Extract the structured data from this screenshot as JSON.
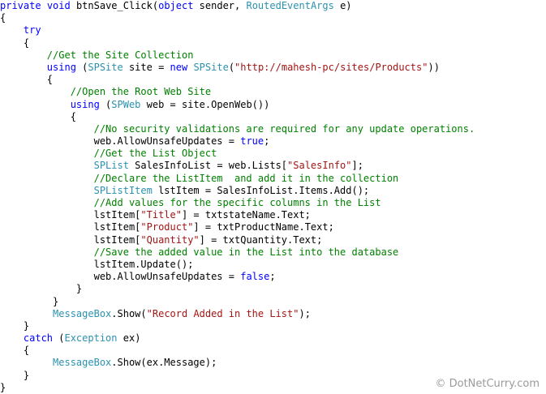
{
  "colors": {
    "keyword": "#0000ff",
    "type": "#2b91af",
    "string": "#a31515",
    "comment": "#008000",
    "plain": "#000000",
    "background": "#ffffff"
  },
  "code": {
    "lines": [
      [
        {
          "t": "kw",
          "v": "private"
        },
        {
          "t": "pl",
          "v": " "
        },
        {
          "t": "kw",
          "v": "void"
        },
        {
          "t": "pl",
          "v": " btnSave_Click("
        },
        {
          "t": "kw",
          "v": "object"
        },
        {
          "t": "pl",
          "v": " sender, "
        },
        {
          "t": "ty",
          "v": "RoutedEventArgs"
        },
        {
          "t": "pl",
          "v": " e)"
        }
      ],
      [
        {
          "t": "pl",
          "v": "{"
        }
      ],
      [
        {
          "t": "pl",
          "v": "    "
        },
        {
          "t": "kw",
          "v": "try"
        }
      ],
      [
        {
          "t": "pl",
          "v": "    {"
        }
      ],
      [
        {
          "t": "pl",
          "v": "        "
        },
        {
          "t": "cm",
          "v": "//Get the Site Collection"
        }
      ],
      [
        {
          "t": "pl",
          "v": "        "
        },
        {
          "t": "kw",
          "v": "using"
        },
        {
          "t": "pl",
          "v": " ("
        },
        {
          "t": "ty",
          "v": "SPSite"
        },
        {
          "t": "pl",
          "v": " site = "
        },
        {
          "t": "kw",
          "v": "new"
        },
        {
          "t": "pl",
          "v": " "
        },
        {
          "t": "ty",
          "v": "SPSite"
        },
        {
          "t": "pl",
          "v": "("
        },
        {
          "t": "st",
          "v": "\"http://mahesh-pc/sites/Products\""
        },
        {
          "t": "pl",
          "v": "))"
        }
      ],
      [
        {
          "t": "pl",
          "v": "        {"
        }
      ],
      [
        {
          "t": "pl",
          "v": "            "
        },
        {
          "t": "cm",
          "v": "//Open the Root Web Site"
        }
      ],
      [
        {
          "t": "pl",
          "v": "            "
        },
        {
          "t": "kw",
          "v": "using"
        },
        {
          "t": "pl",
          "v": " ("
        },
        {
          "t": "ty",
          "v": "SPWeb"
        },
        {
          "t": "pl",
          "v": " web = site.OpenWeb())"
        }
      ],
      [
        {
          "t": "pl",
          "v": "            {"
        }
      ],
      [
        {
          "t": "pl",
          "v": "                "
        },
        {
          "t": "cm",
          "v": "//No security validations are required for any update operations."
        }
      ],
      [
        {
          "t": "pl",
          "v": "                web.AllowUnsafeUpdates = "
        },
        {
          "t": "kw",
          "v": "true"
        },
        {
          "t": "pl",
          "v": ";"
        }
      ],
      [
        {
          "t": "pl",
          "v": "                "
        },
        {
          "t": "cm",
          "v": "//Get the List Object"
        }
      ],
      [
        {
          "t": "pl",
          "v": "                "
        },
        {
          "t": "ty",
          "v": "SPList"
        },
        {
          "t": "pl",
          "v": " SalesInfoList = web.Lists["
        },
        {
          "t": "st",
          "v": "\"SalesInfo\""
        },
        {
          "t": "pl",
          "v": "];"
        }
      ],
      [
        {
          "t": "pl",
          "v": "                "
        },
        {
          "t": "cm",
          "v": "//Declare the ListItem  and add it in the collection"
        }
      ],
      [
        {
          "t": "pl",
          "v": "                "
        },
        {
          "t": "ty",
          "v": "SPListItem"
        },
        {
          "t": "pl",
          "v": " lstItem = SalesInfoList.Items.Add();"
        }
      ],
      [
        {
          "t": "pl",
          "v": "                "
        },
        {
          "t": "cm",
          "v": "//Add values for the specific columns in the List"
        }
      ],
      [
        {
          "t": "pl",
          "v": "                lstItem["
        },
        {
          "t": "st",
          "v": "\"Title\""
        },
        {
          "t": "pl",
          "v": "] = txtstateName.Text;"
        }
      ],
      [
        {
          "t": "pl",
          "v": "                lstItem["
        },
        {
          "t": "st",
          "v": "\"Product\""
        },
        {
          "t": "pl",
          "v": "] = txtProductName.Text;"
        }
      ],
      [
        {
          "t": "pl",
          "v": "                lstItem["
        },
        {
          "t": "st",
          "v": "\"Quantity\""
        },
        {
          "t": "pl",
          "v": "] = txtQuantity.Text;"
        }
      ],
      [
        {
          "t": "pl",
          "v": "                "
        },
        {
          "t": "cm",
          "v": "//Save the added value in the List into the database"
        }
      ],
      [
        {
          "t": "pl",
          "v": "                lstItem.Update();"
        }
      ],
      [
        {
          "t": "pl",
          "v": "                web.AllowUnsafeUpdates = "
        },
        {
          "t": "kw",
          "v": "false"
        },
        {
          "t": "pl",
          "v": ";"
        }
      ],
      [
        {
          "t": "pl",
          "v": "             }"
        }
      ],
      [
        {
          "t": "pl",
          "v": "         }"
        }
      ],
      [
        {
          "t": "pl",
          "v": "         "
        },
        {
          "t": "ty",
          "v": "MessageBox"
        },
        {
          "t": "pl",
          "v": ".Show("
        },
        {
          "t": "st",
          "v": "\"Record Added in the List\""
        },
        {
          "t": "pl",
          "v": ");"
        }
      ],
      [
        {
          "t": "pl",
          "v": "    }"
        }
      ],
      [
        {
          "t": "pl",
          "v": "    "
        },
        {
          "t": "kw",
          "v": "catch"
        },
        {
          "t": "pl",
          "v": " ("
        },
        {
          "t": "ty",
          "v": "Exception"
        },
        {
          "t": "pl",
          "v": " ex)"
        }
      ],
      [
        {
          "t": "pl",
          "v": "    {"
        }
      ],
      [
        {
          "t": "pl",
          "v": "         "
        },
        {
          "t": "ty",
          "v": "MessageBox"
        },
        {
          "t": "pl",
          "v": ".Show(ex.Message);"
        }
      ],
      [
        {
          "t": "pl",
          "v": "    }"
        }
      ],
      [
        {
          "t": "pl",
          "v": "}"
        }
      ]
    ]
  },
  "watermark": {
    "text": "© DotNetCurry.com"
  }
}
